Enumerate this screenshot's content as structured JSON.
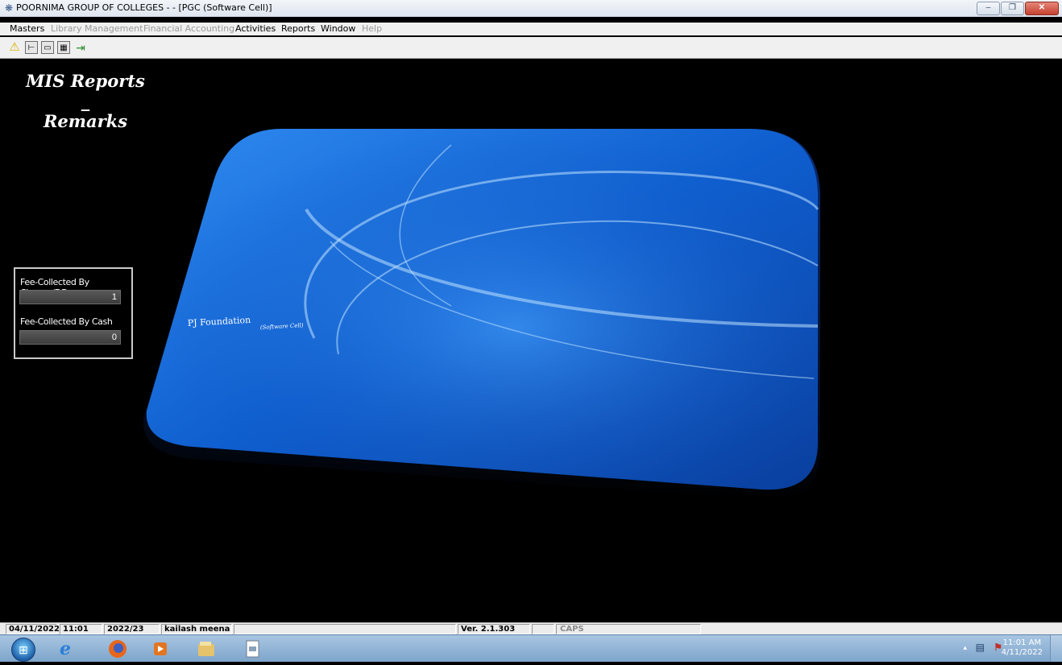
{
  "window": {
    "title": "POORNIMA GROUP OF COLLEGES - - [PGC (Software Cell)]",
    "buttons": [
      "–",
      "❐",
      "✕"
    ]
  },
  "menu": {
    "items": [
      {
        "label": "Masters",
        "enabled": true
      },
      {
        "label": "Library Management",
        "enabled": false
      },
      {
        "label": "Financial Accounting",
        "enabled": false
      },
      {
        "label": "Activities",
        "enabled": true
      },
      {
        "label": "Reports",
        "enabled": true
      },
      {
        "label": "Window",
        "enabled": true
      },
      {
        "label": "Help",
        "enabled": false
      }
    ]
  },
  "toolbar": {
    "icons": [
      "warning-icon",
      "form-icon",
      "card-icon",
      "grid-icon",
      "exit-icon"
    ]
  },
  "main": {
    "mis_title_line1": "MIS Reports _",
    "mis_title_line2": "Remarks",
    "logo_text": "PJ Foundation",
    "logo_subtext": "(Software Cell)",
    "brand_color": "#1565d8"
  },
  "fee_panel": {
    "cheque_label": "Fee-Collected By Cheque/DD",
    "cheque_value": "1",
    "cash_label": "Fee-Collected By Cash",
    "cash_value": "0"
  },
  "status": {
    "date": "04/11/2022",
    "time": "11:01 AM",
    "session": "2022/23",
    "user": "kailash meena",
    "version": "Ver. 2.1.303",
    "caps": "CAPS"
  },
  "taskbar": {
    "clock_time": "11:01 AM",
    "clock_date": "4/11/2022",
    "apps": [
      "start-orb",
      "internet-explorer-icon",
      "firefox-icon",
      "media-player-icon",
      "file-explorer-icon",
      "document-icon"
    ]
  }
}
